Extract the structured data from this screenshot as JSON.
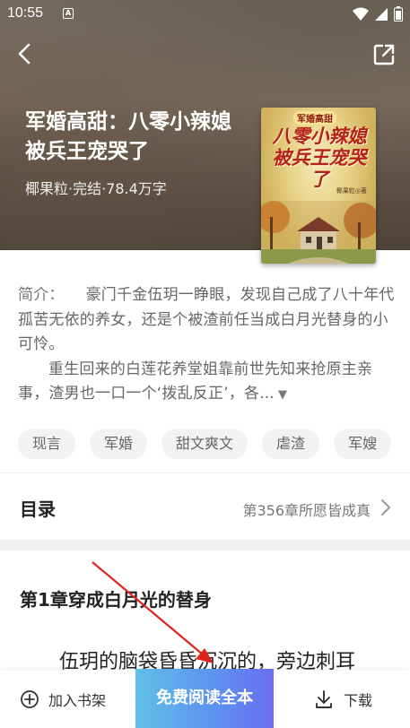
{
  "status_bar": {
    "time": "10:55",
    "indicator": "A"
  },
  "header": {
    "title": "军婚高甜：八零小辣媳被兵王宠哭了",
    "meta": "椰果粒·完结·78.4万字"
  },
  "cover": {
    "badge": "军婚高甜",
    "title": "八零小辣媳被兵王宠哭了",
    "author": "椰果粒◎著"
  },
  "intro": {
    "label": "简介：",
    "paragraph1": "豪门千金伍玥一睁眼，发现自己成了八十年代孤苦无依的养女，还是个被渣前任当成白月光替身的小可怜。",
    "paragraph2": "重生回来的白莲花养堂姐靠前世先知来抢原主亲事，渣男也一口一个‘拨乱反正’，各...",
    "expand_icon": "▼"
  },
  "tags": [
    "现言",
    "军婚",
    "甜文爽文",
    "虐渣",
    "军嫂"
  ],
  "toc": {
    "title": "目录",
    "latest": "第356章所愿皆成真"
  },
  "chapter": {
    "title": "第1章穿成白月光的替身",
    "text": "伍玥的脑袋昏昏沉沉的，旁边刺耳"
  },
  "bottom_bar": {
    "add_shelf": "加入书架",
    "read_free": "免费阅读全本",
    "download": "下载"
  },
  "colors": {
    "primary_gradient_start": "#5fc0e6",
    "primary_gradient_end": "#6a6ef0",
    "annotation_arrow": "#e0241b"
  }
}
